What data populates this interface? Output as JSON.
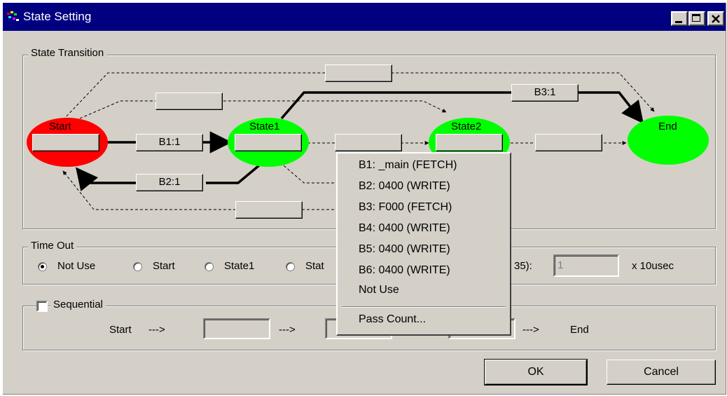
{
  "window": {
    "title": "State Setting"
  },
  "state_transition": {
    "label": "State Transition",
    "states": {
      "start": "Start",
      "state1": "State1",
      "state2": "State2",
      "end": "End"
    },
    "conditions": {
      "b1": "B1:1",
      "b2": "B2:1",
      "b3": "B3:1"
    }
  },
  "context_menu": {
    "items": [
      "B1: _main (FETCH)",
      "B2: 0400 (WRITE)",
      "B3: F000 (FETCH)",
      "B4: 0400 (WRITE)",
      "B5: 0400 (WRITE)",
      "B6: 0400 (WRITE)",
      "Not Use"
    ],
    "pass_count": "Pass Count..."
  },
  "time_out": {
    "label": "Time Out",
    "options": [
      "Not Use",
      "Start",
      "State1",
      "Stat"
    ],
    "selected": "Not Use",
    "suffix_label": "35):",
    "value": "1",
    "unit": "x 10usec"
  },
  "sequential": {
    "label": "Sequential",
    "checked": false,
    "start": "Start",
    "arrow": "--->",
    "end": "End"
  },
  "buttons": {
    "ok": "OK",
    "cancel": "Cancel"
  },
  "colors": {
    "title_bg": "#000080",
    "start_state": "#ff0000",
    "active_state": "#00ff00",
    "face": "#d4d0c8"
  }
}
